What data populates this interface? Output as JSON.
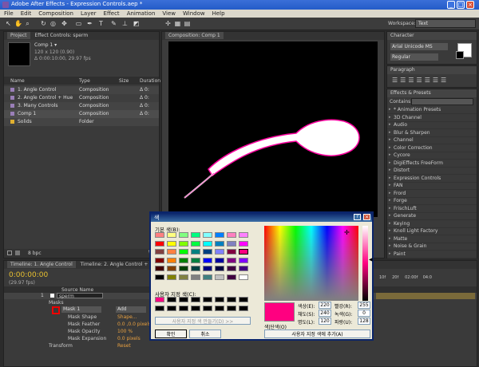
{
  "window": {
    "title": "Adobe After Effects - Expression Controls.aep *"
  },
  "menu": [
    "File",
    "Edit",
    "Composition",
    "Layer",
    "Effect",
    "Animation",
    "View",
    "Window",
    "Help"
  ],
  "toolbar": {
    "workspace_label": "Workspace:",
    "workspace_value": "Text"
  },
  "project_panel": {
    "tab_project": "Project",
    "tab_effects": "Effect Controls: sperm",
    "item_name": "Comp 1 ▾",
    "item_size": "120 x 120 (0.90)",
    "item_duration": "Δ 0:00:10:00, 29.97 fps",
    "columns": [
      "Name",
      "Type",
      "Size",
      "Duration"
    ],
    "rows": [
      {
        "name": "1. Angle Control",
        "type": "Composition",
        "size": "",
        "dur": "Δ 0:",
        "color": "#9a7fb8"
      },
      {
        "name": "2. Angle Control + Hue",
        "type": "Composition",
        "size": "",
        "dur": "Δ 0:",
        "color": "#9a7fb8"
      },
      {
        "name": "3. Many Controls",
        "type": "Composition",
        "size": "",
        "dur": "Δ 0:",
        "color": "#9a7fb8"
      },
      {
        "name": "Comp 1",
        "type": "Composition",
        "size": "",
        "dur": "Δ 0:",
        "color": "#9a7fb8"
      },
      {
        "name": "Solids",
        "type": "Folder",
        "size": "",
        "dur": "",
        "color": "#e0b030"
      }
    ],
    "bpc": "8 bpc"
  },
  "comp_panel": {
    "tab": "Composition: Comp 1"
  },
  "character_panel": {
    "tab": "Character",
    "font": "Arial Unicode MS",
    "style": "Regular"
  },
  "paragraph_panel": {
    "tab": "Paragraph"
  },
  "effects_panel": {
    "tab": "Effects & Presets",
    "contains_label": "Contains:",
    "items": [
      "* Animation Presets",
      "3D Channel",
      "Audio",
      "Blur & Sharpen",
      "Channel",
      "Color Correction",
      "Cycore",
      "DigiEffects FreeForm",
      "Distort",
      "Expression Controls",
      "FAN",
      "Frord",
      "Forge",
      "FrischLuft",
      "Generate",
      "Keying",
      "Knoll Light Factory",
      "Matte",
      "Noise & Grain",
      "Paint"
    ]
  },
  "timeline": {
    "tab1": "Timeline: 1. Angle Control",
    "tab2": "Timeline: 2. Angle Control + Hue",
    "timecode": "0:00:00:00",
    "fps": "(29.97 fps)",
    "column_source": "Source Name",
    "layer_num": "1",
    "layer_name": "sperm",
    "masks_label": "Masks",
    "mask1": "Mask 1",
    "mode": "Add",
    "rows": [
      {
        "label": "Mask Shape",
        "value": "Shape..."
      },
      {
        "label": "Mask Feather",
        "value": "0.0 ,0.0 pixels"
      },
      {
        "label": "Mask Opacity",
        "value": "100 %"
      },
      {
        "label": "Mask Expansion",
        "value": "0.0 pixels"
      },
      {
        "label": "Transform",
        "value": "Reset"
      }
    ],
    "ruler": [
      "10f",
      "20f",
      "01:00f",
      "10f",
      "20f",
      "02:00f",
      "10f",
      "20f",
      "03:00f",
      "04:0"
    ]
  },
  "color_dialog": {
    "title": "색",
    "basic_label": "기본 색(B):",
    "custom_label": "사용자 지정 색(C):",
    "define_button": "사용자 지정 색 만들기(D) >>",
    "ok": "확인",
    "cancel": "취소",
    "solid_label": "색|단색(O)",
    "add_button": "사용자 지정 색에 추가(A)",
    "hue_label": "색상(E):",
    "hue": "220",
    "sat_label": "채도(S):",
    "sat": "240",
    "lum_label": "명도(L):",
    "lum": "120",
    "red_label": "빨강(R):",
    "red": "255",
    "green_label": "녹색(G):",
    "green": "0",
    "blue_label": "파랑(U):",
    "blue": "128",
    "selected_color": "#ff0080",
    "basic_colors": [
      "#ff8080",
      "#ffff80",
      "#80ff80",
      "#00ff80",
      "#80ffff",
      "#0080ff",
      "#ff80c0",
      "#ff80ff",
      "#ff0000",
      "#ffff00",
      "#80ff00",
      "#00ff40",
      "#00ffff",
      "#0080c0",
      "#8080c0",
      "#ff00ff",
      "#804040",
      "#ff8040",
      "#00ff00",
      "#008080",
      "#004080",
      "#8080ff",
      "#800040",
      "#ff0080",
      "#800000",
      "#ff8000",
      "#008000",
      "#008040",
      "#0000ff",
      "#0000a0",
      "#800080",
      "#8000ff",
      "#400000",
      "#804000",
      "#004000",
      "#004040",
      "#000080",
      "#000040",
      "#400040",
      "#400080",
      "#000000",
      "#808000",
      "#808040",
      "#808080",
      "#408080",
      "#c0c0c0",
      "#400040",
      "#ffffff"
    ],
    "custom_colors": [
      "#ff0080",
      "#000000",
      "#000000",
      "#000000",
      "#000000",
      "#000000",
      "#000000",
      "#000000",
      "#000000",
      "#000000",
      "#000000",
      "#000000",
      "#000000",
      "#000000",
      "#000000",
      "#000000"
    ]
  }
}
